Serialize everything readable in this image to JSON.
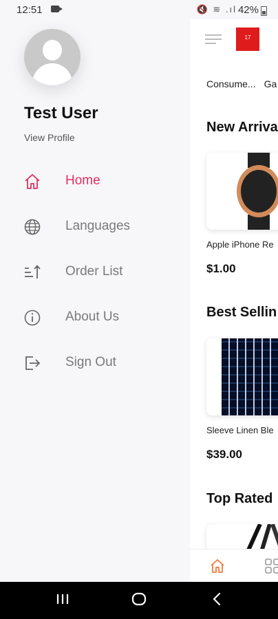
{
  "status_bar": {
    "time": "12:51",
    "battery": "42%"
  },
  "drawer": {
    "user_name": "Test User",
    "view_profile": "View Profile",
    "items": [
      {
        "label": "Home",
        "icon": "home-icon",
        "active": true
      },
      {
        "label": "Languages",
        "icon": "globe-icon"
      },
      {
        "label": "Order List",
        "icon": "sort-icon"
      },
      {
        "label": "About Us",
        "icon": "info-icon"
      },
      {
        "label": "Sign Out",
        "icon": "sign-out-icon"
      }
    ]
  },
  "content": {
    "badge": "17",
    "categories": [
      "Consume...",
      "Ga"
    ],
    "sections": [
      {
        "title": "New Arriva",
        "product": "Apple iPhone Re",
        "price": "$1.00"
      },
      {
        "title": "Best Sellin",
        "product": "Sleeve Linen Ble",
        "price": "$39.00"
      },
      {
        "title": "Top Rated"
      }
    ]
  },
  "colors": {
    "accent": "#e0305f",
    "badge": "#e01b1b"
  }
}
